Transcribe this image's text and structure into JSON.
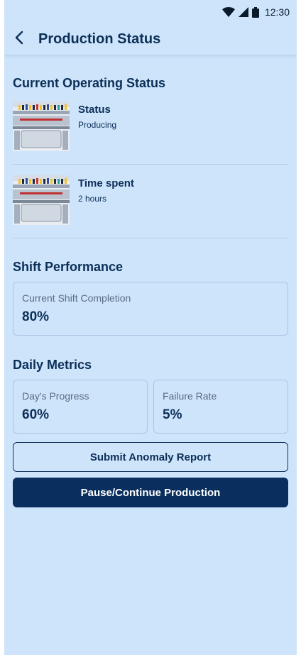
{
  "status_bar": {
    "time": "12:30"
  },
  "header": {
    "title": "Production Status"
  },
  "operating_status": {
    "title": "Current Operating Status",
    "items": [
      {
        "title": "Status",
        "value": "Producing",
        "image": "knitting-machine-image"
      },
      {
        "title": "Time spent",
        "value": "2 hours",
        "image": "knitting-machine-image"
      }
    ]
  },
  "shift_performance": {
    "title": "Shift Performance",
    "completion": {
      "label": "Current Shift Completion",
      "value": "80%"
    }
  },
  "daily_metrics": {
    "title": "Daily Metrics",
    "progress": {
      "label": "Day's Progress",
      "value": "60%"
    },
    "failure": {
      "label": "Failure Rate",
      "value": "5%"
    }
  },
  "actions": {
    "report_label": "Submit Anomaly Report",
    "pause_label": "Pause/Continue Production"
  },
  "colors": {
    "background": "#cde4fb",
    "primary": "#0a2f5e",
    "text": "#0c2f57",
    "muted_text": "#5a6e83",
    "border": "#a9c6e3"
  }
}
